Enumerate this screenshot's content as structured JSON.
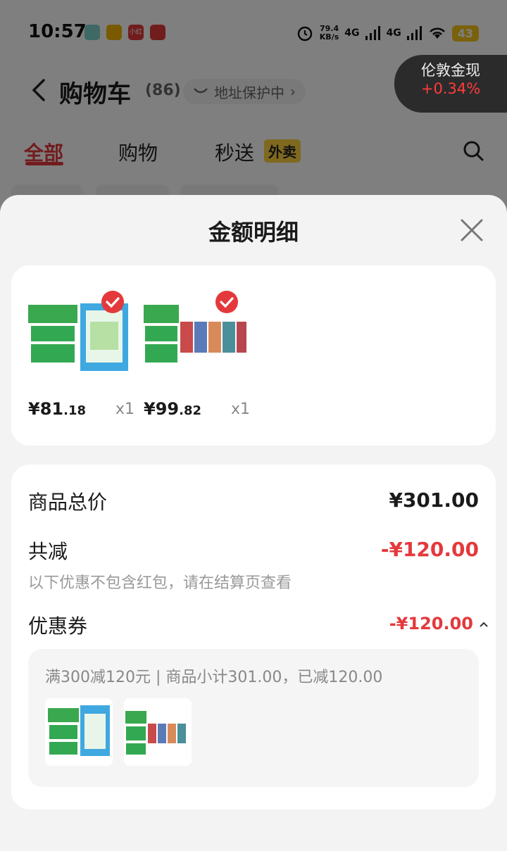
{
  "status_bar": {
    "time": "10:57",
    "apps": [
      "小红书",
      "微博"
    ],
    "net_speed_value": "79.4",
    "net_speed_unit": "KB/s",
    "signal_1": "4G",
    "signal_2": "4G",
    "battery": "43"
  },
  "nav": {
    "title": "购物车",
    "count": "(86)",
    "address_protect": "地址保护中"
  },
  "tabs": [
    {
      "label": "全部",
      "active": true
    },
    {
      "label": "购物",
      "active": false
    },
    {
      "label": "秒送",
      "active": false
    }
  ],
  "takeout_badge": "外卖",
  "ticker": {
    "name": "伦敦金现",
    "change": "+0.34%"
  },
  "sheet": {
    "title": "金额明细",
    "items": [
      {
        "price_int": "¥81",
        "price_dec": ".18",
        "qty": "x1"
      },
      {
        "price_int": "¥99",
        "price_dec": ".82",
        "qty": "x1"
      }
    ],
    "summary": {
      "total_label": "商品总价",
      "total_value": "¥301.00",
      "reduce_label": "共减",
      "reduce_value": "-¥120.00",
      "note": "以下优惠不包含红包，请在结算页查看",
      "coupon_label": "优惠券",
      "coupon_value": "-¥120.00",
      "coupon_detail": "满300减120元 | 商品小计301.00，已减120.00"
    }
  },
  "colors": {
    "accent": "#e4393c",
    "badge": "#ffd23f"
  }
}
